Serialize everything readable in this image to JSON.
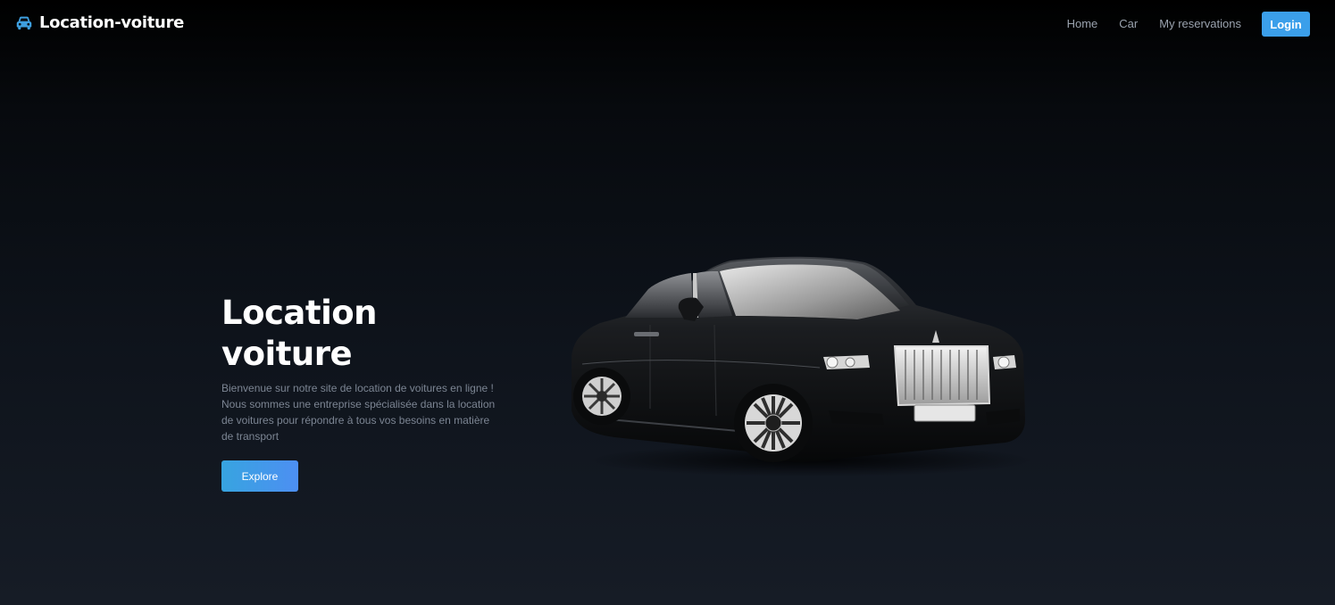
{
  "brand": {
    "icon": "car-icon",
    "name": "Location-voiture",
    "icon_color": "#3e9fe0"
  },
  "nav": {
    "links": [
      {
        "label": "Home"
      },
      {
        "label": "Car"
      },
      {
        "label": "My reservations"
      }
    ],
    "login_label": "Login",
    "accent": "#3b9fea"
  },
  "hero": {
    "title": "Location voiture",
    "description": "Bienvenue sur notre site de location de voitures en ligne ! Nous sommes une entreprise spécialisée dans la location de voitures pour répondre à tous vos besoins en matière de transport",
    "cta_label": "Explore",
    "image": "black-luxury-sedan"
  }
}
